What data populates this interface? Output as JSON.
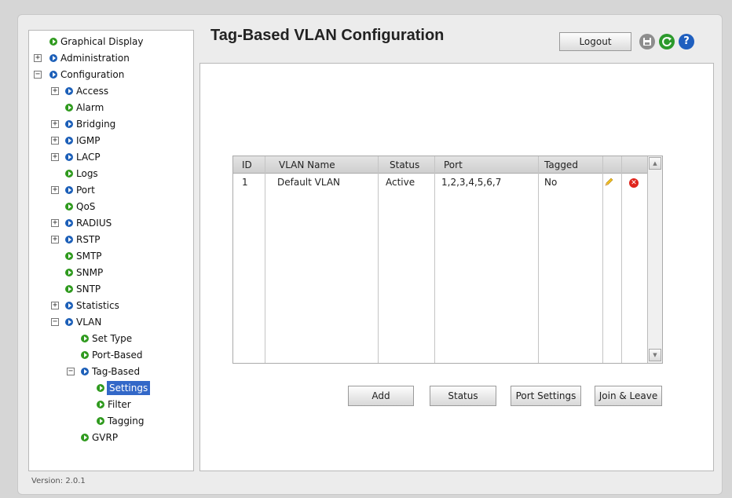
{
  "page": {
    "title": "Tag-Based VLAN Configuration",
    "version": "Version: 2.0.1"
  },
  "header": {
    "logout_label": "Logout"
  },
  "sidebar": {
    "items": [
      {
        "label": "Graphical Display",
        "expander": ""
      },
      {
        "label": "Administration",
        "expander": "+"
      },
      {
        "label": "Configuration",
        "expander": "−"
      },
      {
        "label": "Access",
        "expander": "+"
      },
      {
        "label": "Alarm",
        "expander": ""
      },
      {
        "label": "Bridging",
        "expander": "+"
      },
      {
        "label": "IGMP",
        "expander": "+"
      },
      {
        "label": "LACP",
        "expander": "+"
      },
      {
        "label": "Logs",
        "expander": ""
      },
      {
        "label": "Port",
        "expander": "+"
      },
      {
        "label": "QoS",
        "expander": ""
      },
      {
        "label": "RADIUS",
        "expander": "+"
      },
      {
        "label": "RSTP",
        "expander": "+"
      },
      {
        "label": "SMTP",
        "expander": ""
      },
      {
        "label": "SNMP",
        "expander": ""
      },
      {
        "label": "SNTP",
        "expander": ""
      },
      {
        "label": "Statistics",
        "expander": "+"
      },
      {
        "label": "VLAN",
        "expander": "−"
      },
      {
        "label": "Set Type",
        "expander": ""
      },
      {
        "label": "Port-Based",
        "expander": ""
      },
      {
        "label": "Tag-Based",
        "expander": "−"
      },
      {
        "label": "Settings",
        "expander": ""
      },
      {
        "label": "Filter",
        "expander": ""
      },
      {
        "label": "Tagging",
        "expander": ""
      },
      {
        "label": "GVRP",
        "expander": ""
      }
    ]
  },
  "table": {
    "columns": [
      "ID",
      "VLAN Name",
      "Status",
      "Port",
      "Tagged"
    ],
    "rows": [
      {
        "id": "1",
        "name": "Default VLAN",
        "status": "Active",
        "port": "1,2,3,4,5,6,7",
        "tagged": "No"
      }
    ]
  },
  "buttons": {
    "add": "Add",
    "status": "Status",
    "port_settings": "Port Settings",
    "join_leave": "Join & Leave"
  },
  "colors": {
    "selected": "#3368c8",
    "bullet_green": "#2f9a1e",
    "bullet_blue": "#1c5fb8",
    "delete": "#e0241c"
  },
  "icons": {
    "save": "save-icon",
    "refresh": "refresh-icon",
    "help": "help-icon",
    "edit": "pencil-icon",
    "delete": "delete-icon"
  }
}
